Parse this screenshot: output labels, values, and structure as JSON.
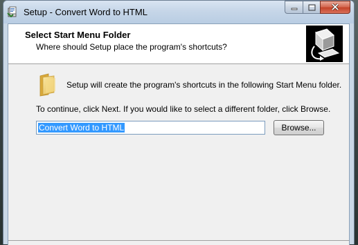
{
  "window": {
    "title": "Setup - Convert Word to HTML",
    "icon": "setup-installer-icon",
    "caption_buttons": [
      "minimize-icon",
      "maximize-icon",
      "close-icon"
    ]
  },
  "header": {
    "title": "Select Start Menu Folder",
    "subtitle": "Where should Setup place the program's shortcuts?",
    "image": "wizard-computer-image"
  },
  "body": {
    "folder_icon": "folder-icon",
    "info_text": "Setup will create the program's shortcuts in the following Start Menu folder.",
    "continue_text": "To continue, click Next. If you would like to select a different folder, click Browse.",
    "folder_input_value": "Convert Word to HTML",
    "browse_label": "Browse..."
  },
  "colors": {
    "selection": "#3399ff",
    "window_frame": "#c9d7e6",
    "close_button": "#c4442a"
  }
}
